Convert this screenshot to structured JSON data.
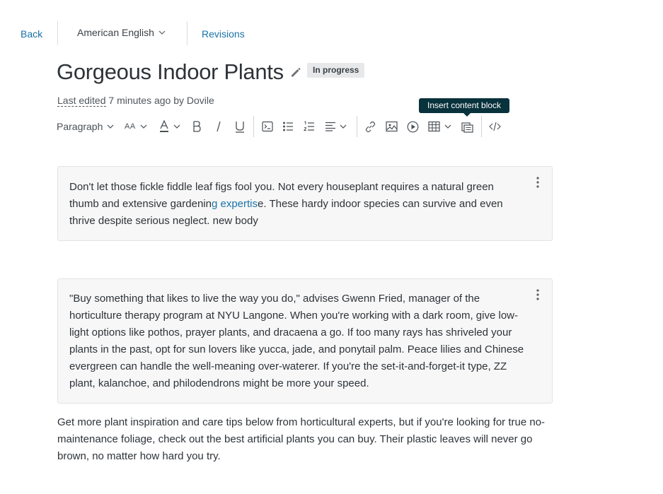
{
  "nav": {
    "back": "Back",
    "language": "American English",
    "revisions": "Revisions"
  },
  "header": {
    "title": "Gorgeous Indoor Plants",
    "status_badge": "In progress",
    "last_edited_label": "Last edited",
    "last_edited_rest": " 7 minutes ago by Dovile"
  },
  "toolbar": {
    "paragraph_select": "Paragraph",
    "font_size_label": "AA",
    "tooltip": "Insert content block",
    "icons": [
      "font-size-icon",
      "text-color-icon",
      "bold-icon",
      "italic-icon",
      "underline-icon",
      "code-block-icon",
      "bulleted-list-icon",
      "numbered-list-icon",
      "align-icon",
      "link-icon",
      "image-icon",
      "media-icon",
      "table-icon",
      "insert-content-block-icon",
      "source-code-icon"
    ]
  },
  "blocks": [
    {
      "text_before": "Don't let those fickle fiddle leaf figs fool you. Not every houseplant requires a natural green thumb and extensive gardenin",
      "link_text": "g expertis",
      "text_after": "e. These hardy indoor species can survive and even thrive despite serious neglect. new body"
    },
    {
      "text": "\"Buy something that likes to live the way you do,\" advises Gwenn Fried, manager of the horticulture therapy program at NYU Langone. When you're working with a dark room, give low-light options like pothos, prayer plants, and dracaena a go. If too many rays has shriveled your plants in the past, opt for sun lovers like yucca, jade, and ponytail palm. Peace lilies and Chinese evergreen can handle the well-meaning over-waterer. If you're the set-it-and-forget-it type, ZZ plant, kalanchoe, and philodendrons might be more your speed."
    }
  ],
  "paragraph": "Get more plant inspiration and care tips below from horticultural experts, but if you're looking for true no-maintenance foliage, check out the best artificial plants you can buy. Their plastic leaves will never go brown, no matter how hard you try.",
  "colors": {
    "link": "#1a73a8",
    "tooltip_bg": "#08323c",
    "block_bg": "#f7f7f7",
    "badge_bg": "#e6e8ea"
  }
}
